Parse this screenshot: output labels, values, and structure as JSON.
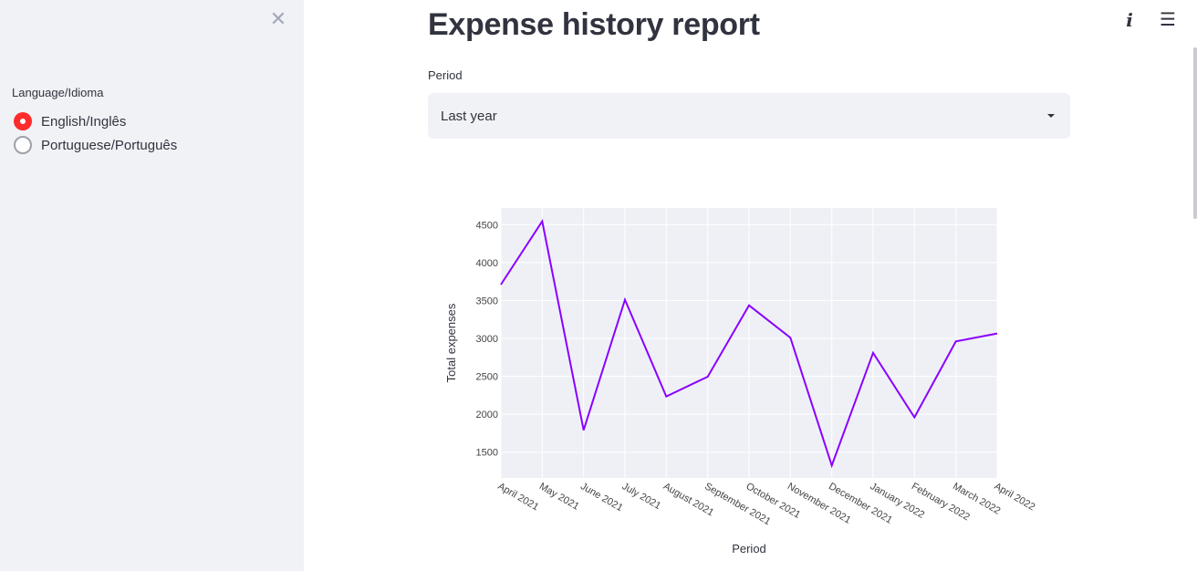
{
  "sidebar": {
    "close_icon": "close-icon",
    "language_label": "Language/Idioma",
    "options": [
      {
        "label": "English/Inglês",
        "checked": true
      },
      {
        "label": "Portuguese/Português",
        "checked": false
      }
    ]
  },
  "toolbar": {
    "info_glyph": "i",
    "menu_glyph": "☰",
    "icons": [
      "info-icon",
      "hamburger-menu-icon"
    ]
  },
  "main": {
    "title": "Expense history report",
    "period_label": "Period",
    "period_value": "Last year"
  },
  "colors": {
    "accent": "#ff2b2b",
    "line": "#8a00ff",
    "plot_bg": "#eff0f6",
    "sidebar_bg": "#f0f2f6"
  },
  "chart_data": {
    "type": "line",
    "title": "",
    "xlabel": "Period",
    "ylabel": "Total expenses",
    "categories": [
      "April 2021",
      "May 2021",
      "June 2021",
      "July 2021",
      "August 2021",
      "September 2021",
      "October 2021",
      "November 2021",
      "December 2021",
      "January 2022",
      "February 2022",
      "March 2022",
      "April 2022"
    ],
    "values": [
      3710,
      4545,
      1790,
      3510,
      2235,
      2495,
      3435,
      3010,
      1325,
      2810,
      1960,
      2960,
      3065
    ],
    "yticks": [
      1500,
      2000,
      2500,
      3000,
      3500,
      4000,
      4500
    ],
    "ylim": [
      1160,
      4720
    ],
    "grid": true,
    "legend": "none"
  }
}
